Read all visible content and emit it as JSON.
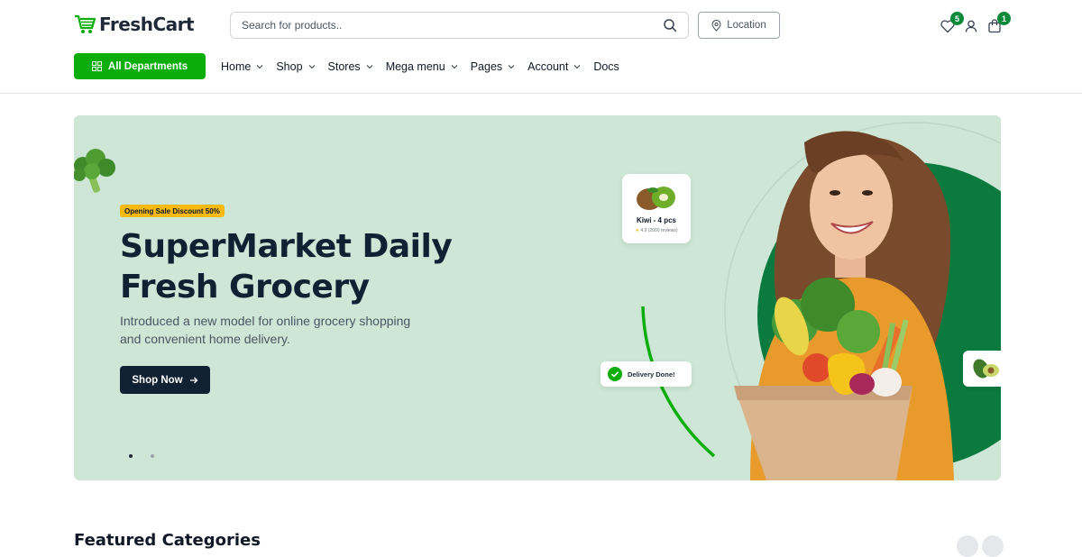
{
  "header": {
    "logo_text": "FreshCart",
    "search": {
      "placeholder": "Search for products.."
    },
    "location_label": "Location",
    "wishlist_count": "5",
    "cart_count": "1"
  },
  "nav": {
    "departments_label": "All Departments",
    "items": [
      {
        "label": "Home",
        "dropdown": true
      },
      {
        "label": "Shop",
        "dropdown": true
      },
      {
        "label": "Stores",
        "dropdown": true
      },
      {
        "label": "Mega menu",
        "dropdown": true
      },
      {
        "label": "Pages",
        "dropdown": true
      },
      {
        "label": "Account",
        "dropdown": true
      },
      {
        "label": "Docs",
        "dropdown": false
      }
    ]
  },
  "hero": {
    "badge": "Opening Sale Discount 50%",
    "title_line1": "SuperMarket Daily",
    "title_line2": "Fresh Grocery",
    "subtitle_line1": "Introduced a new model for online grocery shopping",
    "subtitle_line2": "and convenient home delivery.",
    "cta_label": "Shop Now",
    "product_card": {
      "name": "Kiwi - 4 pcs",
      "rating": "4.9",
      "reviews": "(2000 reviews)"
    },
    "delivery_label": "Delivery Done!",
    "slides_total": 2,
    "active_slide": 1,
    "colors": {
      "background": "#cde6d5",
      "accent": "#0aad0a",
      "circle": "#0a7a3e",
      "badge": "#f5b90f",
      "dark": "#0f2132"
    }
  },
  "section": {
    "title": "Featured Categories"
  }
}
